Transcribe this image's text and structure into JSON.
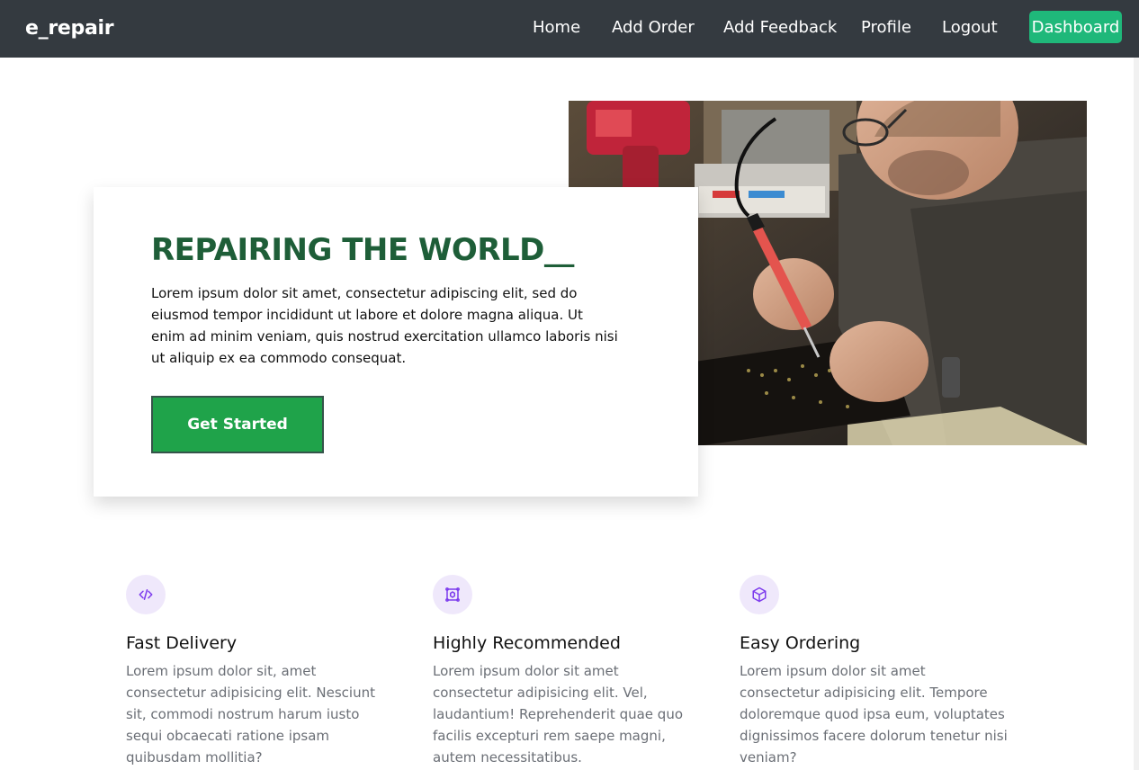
{
  "navbar": {
    "brand": "e_repair",
    "links": [
      "Home",
      "Add Order",
      "Add Feedback",
      "Profile",
      "Logout"
    ],
    "dashboard_label": "Dashboard",
    "background_color": "#343a40",
    "dashboard_color": "#1fb87a"
  },
  "hero": {
    "title": "REPAIRING THE WORLD__",
    "text": "Lorem ipsum dolor sit amet, consectetur adipiscing elit, sed do eiusmod tempor incididunt ut labore et dolore magna aliqua. Ut enim ad minim veniam, quis nostrud exercitation ullamco laboris nisi ut aliquip ex ea commodo consequat.",
    "button_label": "Get Started",
    "image_alt": "technician soldering a circuit board",
    "title_color": "#1e5e38",
    "button_color": "#1fa34a"
  },
  "features": [
    {
      "icon": "code-icon",
      "title": "Fast Delivery",
      "text": "Lorem ipsum dolor sit, amet consectetur adipisicing elit. Nesciunt sit, commodi nostrum harum iusto sequi obcaecati ratione ipsam quibusdam mollitia?"
    },
    {
      "icon": "frame-icon",
      "title": "Highly Recommended",
      "text": "Lorem ipsum dolor sit amet consectetur adipisicing elit. Vel, laudantium! Reprehenderit quae quo facilis excepturi rem saepe magni, autem necessitatibus."
    },
    {
      "icon": "box-icon",
      "title": "Easy Ordering",
      "text": "Lorem ipsum dolor sit amet consectetur adipisicing elit. Tempore doloremque quod ipsa eum, voluptates dignissimos facere dolorum tenetur nisi veniam?"
    }
  ]
}
